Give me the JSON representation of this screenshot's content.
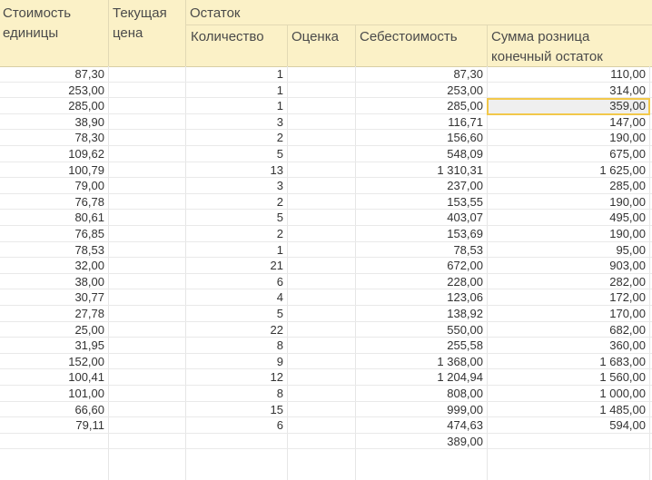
{
  "header": {
    "col_unit_cost": "Стоимость\nединицы",
    "col_current_price": "Текущая\nцена",
    "group_balance": "Остаток",
    "col_quantity": "Количество",
    "col_valuation": "Оценка",
    "col_cost": "Себестоимость",
    "col_retail_sum": "Сумма розница\nконечный остаток"
  },
  "rows": [
    {
      "unit_cost": "87,30",
      "qty": "1",
      "cost": "87,30",
      "retail": "110,00"
    },
    {
      "unit_cost": "253,00",
      "qty": "1",
      "cost": "253,00",
      "retail": "314,00"
    },
    {
      "unit_cost": "285,00",
      "qty": "1",
      "cost": "285,00",
      "retail": "359,00"
    },
    {
      "unit_cost": "38,90",
      "qty": "3",
      "cost": "116,71",
      "retail": "147,00"
    },
    {
      "unit_cost": "78,30",
      "qty": "2",
      "cost": "156,60",
      "retail": "190,00"
    },
    {
      "unit_cost": "109,62",
      "qty": "5",
      "cost": "548,09",
      "retail": "675,00"
    },
    {
      "unit_cost": "100,79",
      "qty": "13",
      "cost": "1 310,31",
      "retail": "1 625,00"
    },
    {
      "unit_cost": "79,00",
      "qty": "3",
      "cost": "237,00",
      "retail": "285,00"
    },
    {
      "unit_cost": "76,78",
      "qty": "2",
      "cost": "153,55",
      "retail": "190,00"
    },
    {
      "unit_cost": "80,61",
      "qty": "5",
      "cost": "403,07",
      "retail": "495,00"
    },
    {
      "unit_cost": "76,85",
      "qty": "2",
      "cost": "153,69",
      "retail": "190,00"
    },
    {
      "unit_cost": "78,53",
      "qty": "1",
      "cost": "78,53",
      "retail": "95,00"
    },
    {
      "unit_cost": "32,00",
      "qty": "21",
      "cost": "672,00",
      "retail": "903,00"
    },
    {
      "unit_cost": "38,00",
      "qty": "6",
      "cost": "228,00",
      "retail": "282,00"
    },
    {
      "unit_cost": "30,77",
      "qty": "4",
      "cost": "123,06",
      "retail": "172,00"
    },
    {
      "unit_cost": "27,78",
      "qty": "5",
      "cost": "138,92",
      "retail": "170,00"
    },
    {
      "unit_cost": "25,00",
      "qty": "22",
      "cost": "550,00",
      "retail": "682,00"
    },
    {
      "unit_cost": "31,95",
      "qty": "8",
      "cost": "255,58",
      "retail": "360,00"
    },
    {
      "unit_cost": "152,00",
      "qty": "9",
      "cost": "1 368,00",
      "retail": "1 683,00"
    },
    {
      "unit_cost": "100,41",
      "qty": "12",
      "cost": "1 204,94",
      "retail": "1 560,00"
    },
    {
      "unit_cost": "101,00",
      "qty": "8",
      "cost": "808,00",
      "retail": "1 000,00"
    },
    {
      "unit_cost": "66,60",
      "qty": "15",
      "cost": "999,00",
      "retail": "1 485,00"
    },
    {
      "unit_cost": "79,11",
      "qty": "6",
      "cost": "474,63",
      "retail": "594,00"
    },
    {
      "unit_cost": "",
      "qty": "",
      "cost": "389,00",
      "retail": ""
    }
  ],
  "selected_row_index": 2,
  "colors": {
    "header_bg": "#fbf1c7",
    "selection_border": "#f2c84b"
  }
}
